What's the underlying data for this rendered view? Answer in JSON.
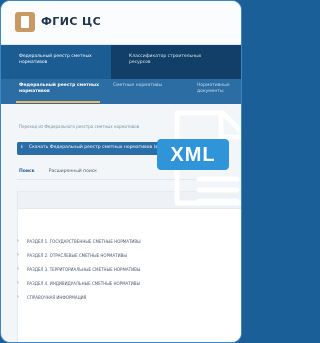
{
  "app": {
    "title": "ФГИС ЦС"
  },
  "nav": {
    "primary_items": [
      {
        "label": "Федеральный реестр сметных нормативов",
        "active": true
      },
      {
        "label": "Классификатор строительных ресурсов",
        "active": false
      }
    ],
    "secondary_items": [
      {
        "label": "Федеральный реестр сметных нормативов",
        "active": true
      },
      {
        "label": "Сметные нормативы",
        "active": false
      },
      {
        "label": "Нормативные документы",
        "active": false
      }
    ]
  },
  "breadcrumb": "Переход из Федерального реестра сметных нормативов",
  "select_button": {
    "label": "Скачать Федеральный реестр сметных нормативов (все)"
  },
  "tabs": [
    {
      "label": "Поиск",
      "active": true
    },
    {
      "label": "Расширенный поиск",
      "active": false
    }
  ],
  "list_items": [
    "РАЗДЕЛ 1. ГОСУДАРСТВЕННЫЕ СМЕТНЫЕ НОРМАТИВЫ",
    "РАЗДЕЛ 2. ОТРАСЛЕВЫЕ СМЕТНЫЕ НОРМАТИВЫ",
    "РАЗДЕЛ 3. ТЕРРИТОРИАЛЬНЫЕ СМЕТНЫЕ НОРМАТИВЫ",
    "РАЗДЕЛ 4. ИНДИВИДУАЛЬНЫЕ СМЕТНЫЕ НОРМАТИВЫ",
    "СПРАВОЧНАЯ ИНФОРМАЦИЯ"
  ],
  "xml_icon": {
    "badge_text": "XML",
    "colors": {
      "badge": "#2f95d8",
      "outline": "#ffffff"
    }
  },
  "colors": {
    "background": "#1a5f98",
    "nav_primary": "#123f68",
    "nav_secondary": "#2c6ea3",
    "accent": "#f0b85f",
    "button": "#2b6da6"
  }
}
